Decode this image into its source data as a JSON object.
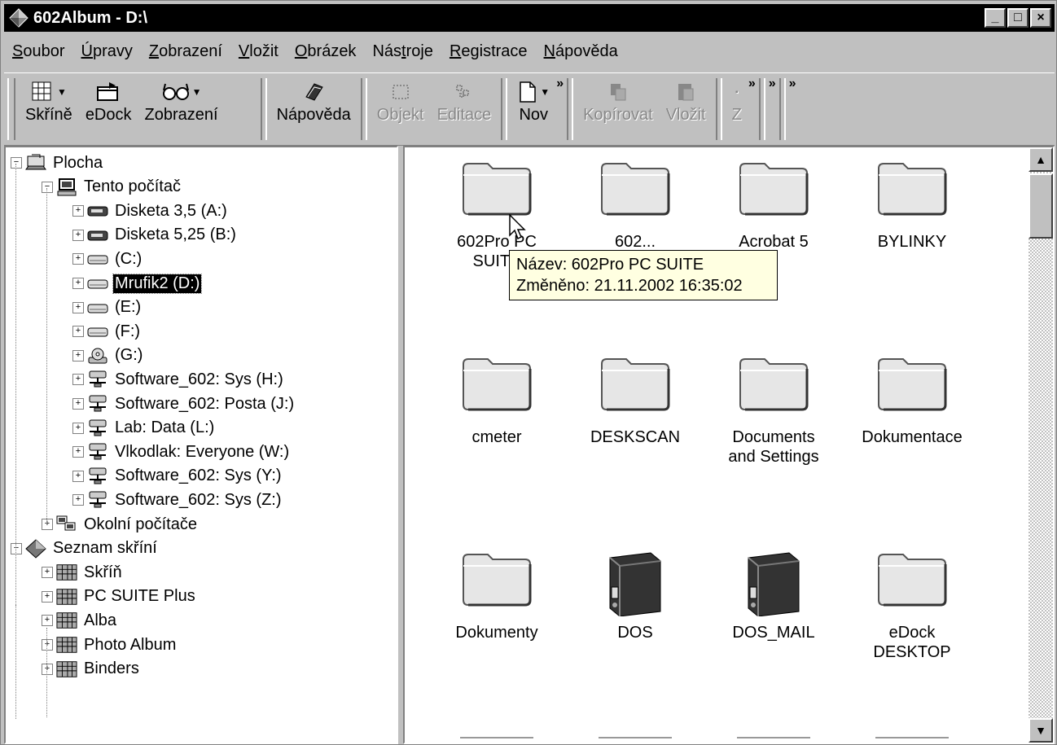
{
  "window": {
    "title": "602Album - D:\\",
    "min_label": "_",
    "max_label": "□",
    "close_label": "×"
  },
  "menu": [
    {
      "pre": "",
      "u": "S",
      "post": "oubor"
    },
    {
      "pre": "",
      "u": "Ú",
      "post": "pravy"
    },
    {
      "pre": "",
      "u": "Z",
      "post": "obrazení"
    },
    {
      "pre": "",
      "u": "V",
      "post": "ložit"
    },
    {
      "pre": "",
      "u": "O",
      "post": "brázek"
    },
    {
      "pre": "Nás",
      "u": "t",
      "post": "roje"
    },
    {
      "pre": "",
      "u": "R",
      "post": "egistrace"
    },
    {
      "pre": "",
      "u": "N",
      "post": "ápověda"
    }
  ],
  "toolbar": {
    "skrine": "Skříně",
    "edock": "eDock",
    "zobrazeni": "Zobrazení",
    "napoveda": "Nápověda",
    "objekt": "Objekt",
    "editace": "Editace",
    "novy": "Nov",
    "kopirovat": "Kopírovat",
    "vlozit": "Vložit",
    "z": "Z",
    "more": "»"
  },
  "tree": {
    "plocha": "Plocha",
    "tento_pocitac": "Tento počítač",
    "drives": [
      {
        "label": "Disketa 3,5 (A:)",
        "icon": "floppy"
      },
      {
        "label": "Disketa 5,25 (B:)",
        "icon": "floppy"
      },
      {
        "label": "(C:)",
        "icon": "hdd"
      },
      {
        "label": "Mrufik2 (D:)",
        "icon": "hdd"
      },
      {
        "label": "(E:)",
        "icon": "hdd"
      },
      {
        "label": "(F:)",
        "icon": "hdd"
      },
      {
        "label": "(G:)",
        "icon": "cdrom"
      },
      {
        "label": "Software_602: Sys (H:)",
        "icon": "network"
      },
      {
        "label": "Software_602: Posta (J:)",
        "icon": "network"
      },
      {
        "label": "Lab: Data (L:)",
        "icon": "network"
      },
      {
        "label": "Vlkodlak: Everyone (W:)",
        "icon": "network"
      },
      {
        "label": "Software_602: Sys (Y:)",
        "icon": "network"
      },
      {
        "label": "Software_602: Sys (Z:)",
        "icon": "network"
      }
    ],
    "okolni": "Okolní počítače",
    "seznam": "Seznam skříní",
    "cabinets": [
      "Skříň",
      "PC SUITE Plus",
      "Alba",
      "Photo Album",
      "Binders"
    ]
  },
  "content": {
    "items": [
      {
        "l1": "602Pro PC",
        "l2": "SUITE",
        "icon": "folder"
      },
      {
        "l1": "602...",
        "l2": "",
        "icon": "folder"
      },
      {
        "l1": "Acrobat 5",
        "l2": "",
        "icon": "folder"
      },
      {
        "l1": "BYLINKY",
        "l2": "",
        "icon": "folder"
      },
      {
        "l1": "cmeter",
        "l2": "",
        "icon": "folder"
      },
      {
        "l1": "DESKSCAN",
        "l2": "",
        "icon": "folder"
      },
      {
        "l1": "Documents",
        "l2": "and Settings",
        "icon": "folder"
      },
      {
        "l1": "Dokumentace",
        "l2": "",
        "icon": "folder"
      },
      {
        "l1": "Dokumenty",
        "l2": "",
        "icon": "folder"
      },
      {
        "l1": "DOS",
        "l2": "",
        "icon": "binder"
      },
      {
        "l1": "DOS_MAIL",
        "l2": "",
        "icon": "binder"
      },
      {
        "l1": "eDock",
        "l2": "DESKTOP",
        "icon": "folder"
      }
    ],
    "tooltip": {
      "line1": "Název: 602Pro PC SUITE",
      "line2": "Změněno: 21.11.2002 16:35:02"
    }
  },
  "scroll": {
    "up": "▲",
    "down": "▼"
  }
}
